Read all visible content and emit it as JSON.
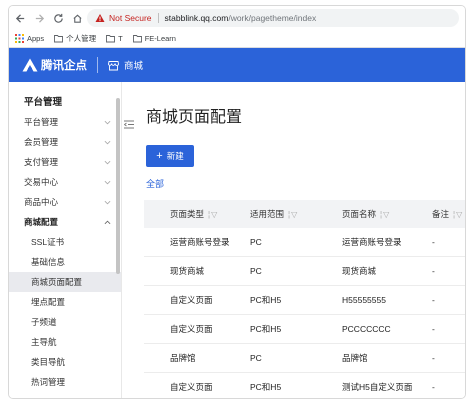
{
  "browser": {
    "security_text": "Not Secure",
    "url_host": "stabblink.qq.com",
    "url_path": "/work/pagetheme/index",
    "bookmarks": [
      {
        "label": "Apps",
        "icon": "apps-grid-icon"
      },
      {
        "label": "个人管理",
        "icon": "folder-icon"
      },
      {
        "label": "T",
        "icon": "folder-icon"
      },
      {
        "label": "FE-Learn",
        "icon": "folder-icon"
      }
    ]
  },
  "header": {
    "logo_text": "腾讯企点",
    "section_label": "商城",
    "accent_color": "#2b63d9"
  },
  "sidebar": {
    "title": "平台管理",
    "items": [
      {
        "label": "平台管理"
      },
      {
        "label": "会员管理"
      },
      {
        "label": "支付管理"
      },
      {
        "label": "交易中心"
      },
      {
        "label": "商品中心"
      }
    ],
    "open_item": {
      "label": "商城配置"
    },
    "sub_items": [
      {
        "label": "SSL证书"
      },
      {
        "label": "基础信息"
      },
      {
        "label": "商城页面配置",
        "active": true
      },
      {
        "label": "埋点配置"
      },
      {
        "label": "子频道"
      },
      {
        "label": "主导航"
      },
      {
        "label": "类目导航"
      },
      {
        "label": "热词管理"
      }
    ]
  },
  "main": {
    "title": "商城页面配置",
    "new_button_label": "新建",
    "filter_label": "全部",
    "table": {
      "headers": [
        "页面类型",
        "适用范围",
        "页面名称",
        "备注"
      ],
      "rows": [
        [
          "运营商账号登录",
          "PC",
          "运营商账号登录",
          "-"
        ],
        [
          "现货商城",
          "PC",
          "现货商城",
          "-"
        ],
        [
          "自定义页面",
          "PC和H5",
          "H55555555",
          "-"
        ],
        [
          "自定义页面",
          "PC和H5",
          "PCCCCCCC",
          "-"
        ],
        [
          "品牌馆",
          "PC",
          "品牌馆",
          "-"
        ],
        [
          "自定义页面",
          "PC和H5",
          "测试H5自定义页面",
          "-"
        ]
      ]
    }
  }
}
